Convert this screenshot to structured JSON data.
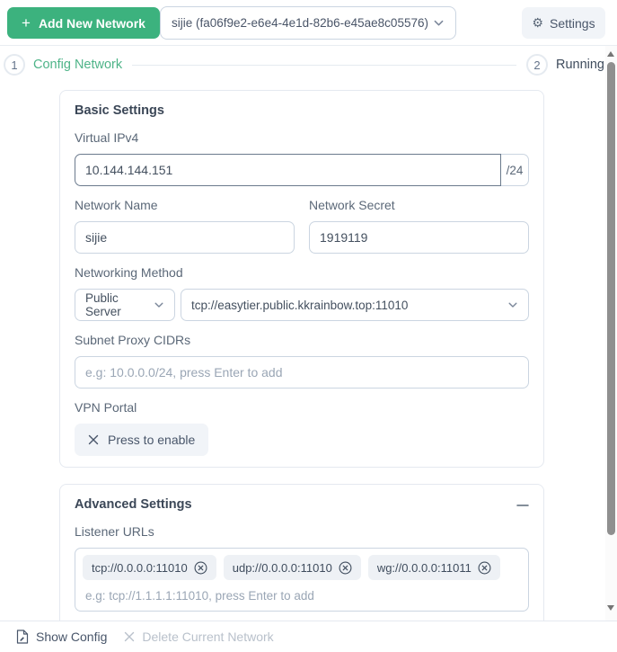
{
  "toolbar": {
    "add_button_label": "Add New Network",
    "network_select_value": "sijie (fa06f9e2-e6e4-4e1d-82b6-e45ae8c05576)",
    "settings_button_label": "Settings"
  },
  "stepper": {
    "step1_number": "1",
    "step1_label": "Config Network",
    "step2_number": "2",
    "step2_label": "Running"
  },
  "basic_settings": {
    "title": "Basic Settings",
    "virtual_ipv4": {
      "label": "Virtual IPv4",
      "value": "10.144.144.151",
      "suffix": "/24"
    },
    "network_name": {
      "label": "Network Name",
      "value": "sijie"
    },
    "network_secret": {
      "label": "Network Secret",
      "value": "1919119"
    },
    "networking_method": {
      "label": "Networking Method",
      "method_value": "Public Server",
      "server_url_value": "tcp://easytier.public.kkrainbow.top:11010"
    },
    "subnet_proxy": {
      "label": "Subnet Proxy CIDRs",
      "placeholder": "e.g: 10.0.0.0/24, press Enter to add"
    },
    "vpn_portal": {
      "label": "VPN Portal",
      "button_label": "Press to enable"
    }
  },
  "advanced_settings": {
    "title": "Advanced Settings",
    "listener_urls": {
      "label": "Listener URLs",
      "chips": [
        "tcp://0.0.0.0:11010",
        "udp://0.0.0.0:11010",
        "wg://0.0.0.0:11011"
      ],
      "placeholder": "e.g: tcp://1.1.1.1:11010, press Enter to add"
    }
  },
  "footer": {
    "show_config_label": "Show Config",
    "delete_network_label": "Delete Current Network"
  },
  "colors": {
    "accent_green": "#3cb27e",
    "step_active_green": "#4eb488",
    "input_border": "#cbd5e1",
    "focused_border": "#6b7a8d",
    "muted_text": "#9aa6b5"
  }
}
